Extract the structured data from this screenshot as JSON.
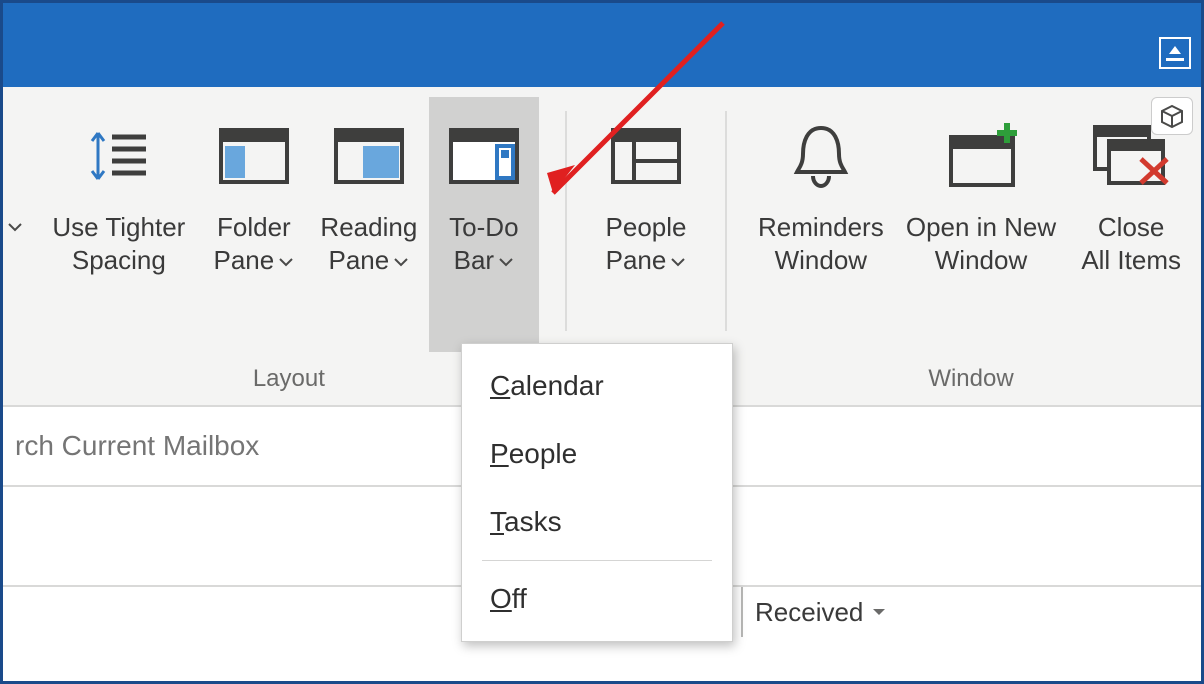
{
  "ribbon": {
    "groups": {
      "layout": {
        "label": "Layout",
        "tighter": {
          "line1": "Use Tighter",
          "line2": "Spacing"
        },
        "folder": {
          "line1": "Folder",
          "line2": "Pane"
        },
        "reading": {
          "line1": "Reading",
          "line2": "Pane"
        },
        "todo": {
          "line1": "To-Do",
          "line2": "Bar"
        }
      },
      "people": {
        "pane": {
          "line1": "People",
          "line2": "Pane"
        }
      },
      "window": {
        "label": "Window",
        "reminders": {
          "line1": "Reminders",
          "line2": "Window"
        },
        "opennew": {
          "line1": "Open in New",
          "line2": "Window"
        },
        "closeall": {
          "line1": "Close",
          "line2": "All Items"
        }
      }
    }
  },
  "todo_menu": {
    "calendar": "Calendar",
    "people": "People",
    "tasks": "Tasks",
    "off": "Off"
  },
  "search": {
    "placeholder": "rch Current Mailbox"
  },
  "sort": {
    "label": "Received"
  }
}
